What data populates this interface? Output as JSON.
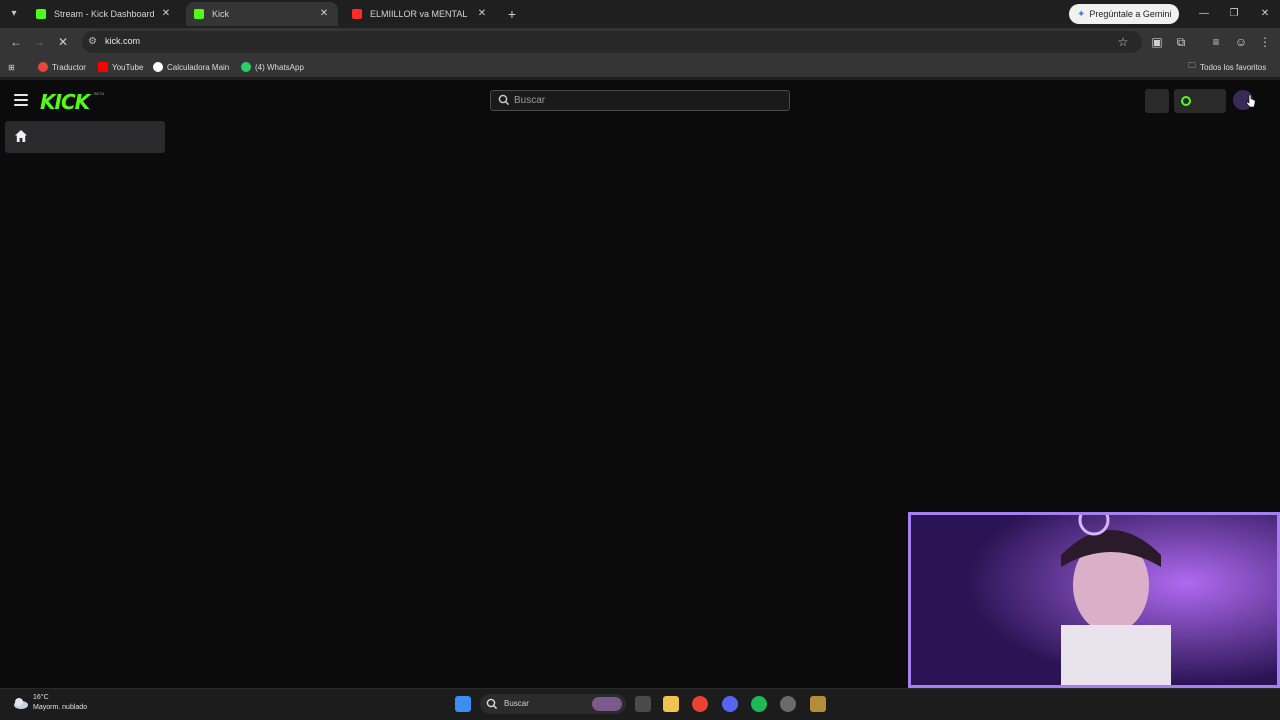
{
  "tabs": [
    {
      "label": "Stream - Kick Dashboard",
      "favicon": "kick-icon"
    },
    {
      "label": "Kick",
      "favicon": "kick-icon",
      "active": true
    },
    {
      "label": "ELMIILLOR va MENTAL | Mejor",
      "favicon": "youtube-icon"
    }
  ],
  "gemini_label": "Pregúntale a Gemini",
  "url": "kick.com",
  "bookmarks": [
    {
      "label": "Traductor",
      "icon": "translate-icon"
    },
    {
      "label": "YouTube",
      "icon": "youtube-icon"
    },
    {
      "label": "Calculadora Main",
      "icon": "google-icon"
    },
    {
      "label": "(4) WhatsApp",
      "icon": "whatsapp-icon"
    }
  ],
  "all_bookmarks_label": "Todos los favoritos",
  "site": {
    "logo": "KICK",
    "logo_badge": "BETA",
    "search_placeholder": "Buscar",
    "accent": "#53fc18"
  },
  "taskbar": {
    "weather_temp": "16°C",
    "weather_desc": "Mayorm. nublado",
    "search_label": "Buscar"
  }
}
